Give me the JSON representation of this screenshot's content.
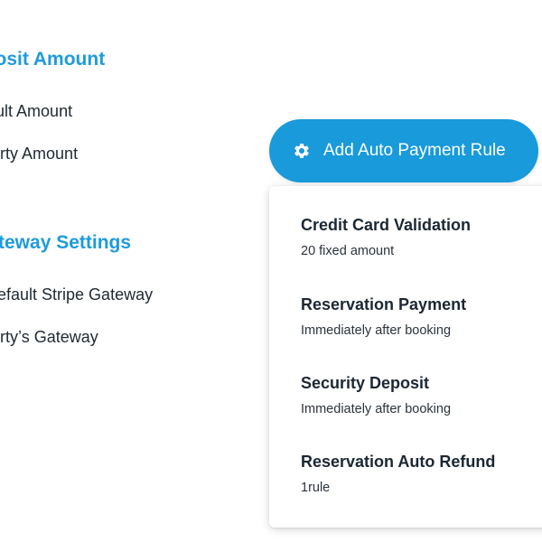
{
  "deposit_amount": {
    "title": "eposit Amount",
    "options": [
      "efault Amount",
      "operty Amount"
    ]
  },
  "gateway_settings": {
    "title": "Gateway Settings",
    "options": [
      "y Default Stripe Gateway",
      "operty’s Gateway"
    ]
  },
  "add_rule_button": {
    "icon": "gear-icon",
    "label": "Add Auto Payment Rule"
  },
  "rules": [
    {
      "title": "Credit Card Validation",
      "subtitle": "20 fixed amount"
    },
    {
      "title": "Reservation Payment",
      "subtitle": "Immediately after booking"
    },
    {
      "title": "Security Deposit",
      "subtitle": "Immediately after booking"
    },
    {
      "title": "Reservation Auto Refund",
      "subtitle": "1rule"
    }
  ],
  "colors": {
    "accent": "#189ADB",
    "heading_blue": "#1E9BDB",
    "text_dark": "#1f2933"
  }
}
